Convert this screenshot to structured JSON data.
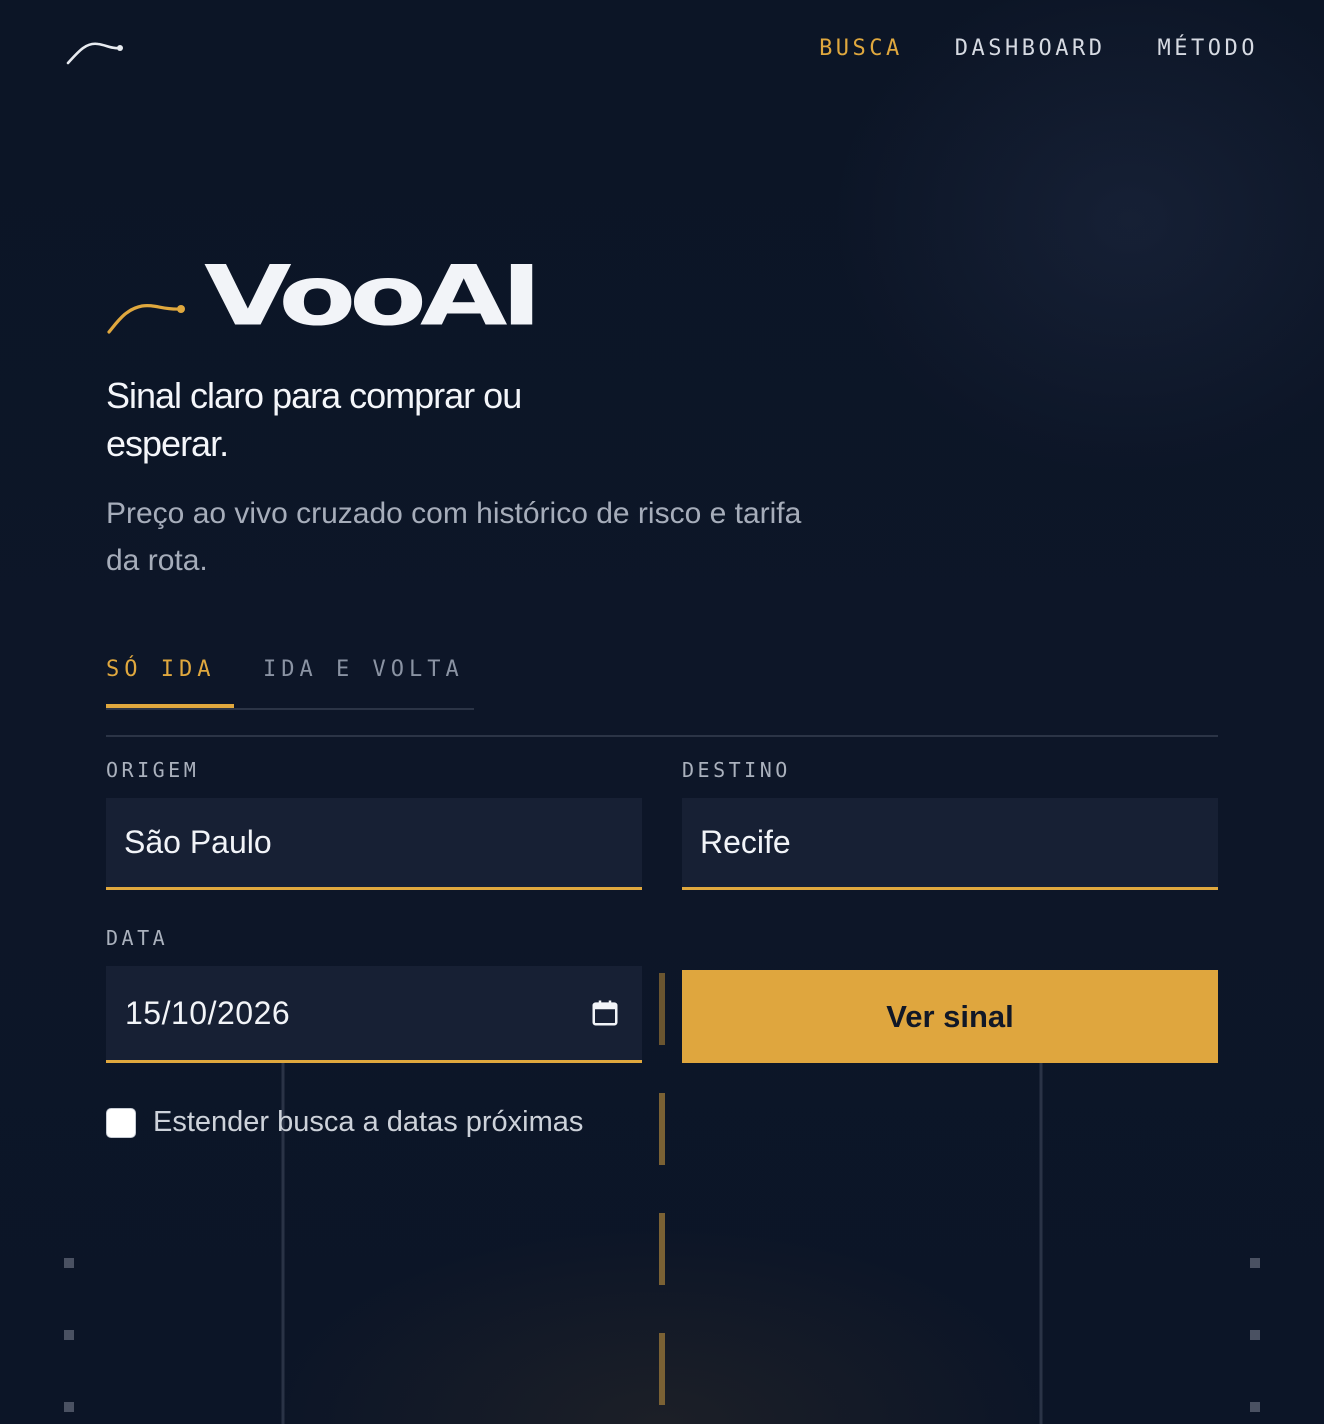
{
  "header": {
    "logo_icon": "swoosh-logo-icon",
    "nav": [
      {
        "label": "BUSCA",
        "active": true
      },
      {
        "label": "DASHBOARD",
        "active": false
      },
      {
        "label": "MÉTODO",
        "active": false
      }
    ]
  },
  "hero": {
    "brand_name": "VooAI",
    "tagline": "Sinal claro para comprar ou esperar.",
    "subtitle": "Preço ao vivo cruzado com histórico de risco e tarifa da rota."
  },
  "trip_tabs": [
    {
      "label": "SÓ IDA",
      "active": true
    },
    {
      "label": "IDA E VOLTA",
      "active": false
    }
  ],
  "form": {
    "origin": {
      "label": "ORIGEM",
      "value": "São Paulo"
    },
    "destination": {
      "label": "DESTINO",
      "value": "Recife"
    },
    "date": {
      "label": "DATA",
      "value": "15/10/2026",
      "icon": "calendar-icon"
    },
    "submit_label": "Ver sinal",
    "extend_label": "Estender busca a datas próximas",
    "extend_checked": false
  },
  "colors": {
    "accent": "#e0a83e",
    "background": "#0c1526",
    "field_background": "#172034",
    "text": "#f2f4f8",
    "muted": "#a6adba"
  }
}
